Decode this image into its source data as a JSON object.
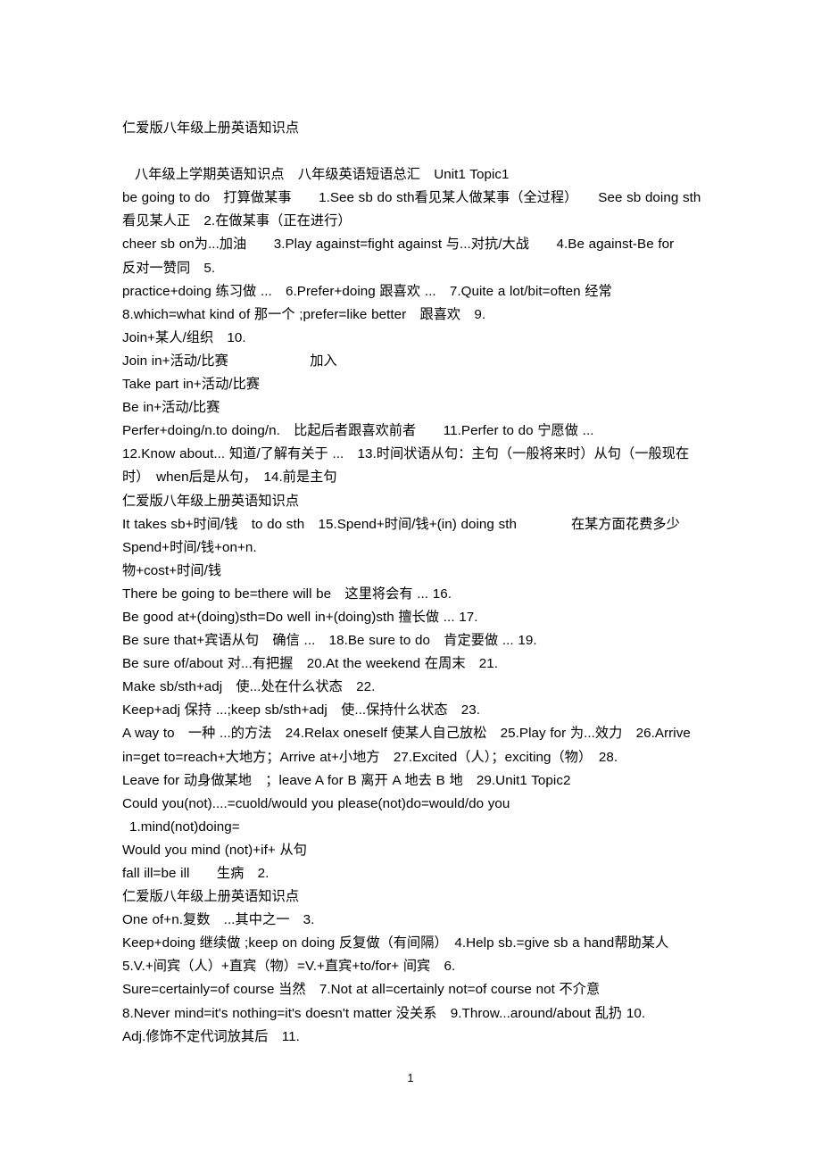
{
  "document": {
    "title": "仁爱版八年级上册英语知识点",
    "page_number": "1",
    "lines": [
      {
        "id": "l01",
        "text": "仁爱版八年级上册英语知识点",
        "indent": "none"
      },
      {
        "id": "l02",
        "text": "",
        "indent": "none"
      },
      {
        "id": "l03",
        "text": "八年级上学期英语知识点　八年级英语短语总汇　Unit1 Topic1",
        "indent": "sm"
      },
      {
        "id": "l04",
        "text": "be going to do　打算做某事　　1.See sb do sth看见某人做某事（全过程）　　See sb doing sth看见某人正　2.在做某事（正在进行）",
        "indent": "none"
      },
      {
        "id": "l05",
        "text": "cheer sb on为...加油　　3.Play against=fight against 与...对抗/大战　　4.Be against-Be for　　反对一赞同　5.",
        "indent": "none"
      },
      {
        "id": "l06",
        "text": "practice+doing 练习做 ...　6.Prefer+doing 跟喜欢 ...　7.Quite a lot/bit=often 经常",
        "indent": "none"
      },
      {
        "id": "l07",
        "text": "8.which=what kind of 那一个 ;prefer=like better　跟喜欢　9.",
        "indent": "none"
      },
      {
        "id": "l08",
        "text": "Join+某人/组织　10.",
        "indent": "none"
      },
      {
        "id": "l09",
        "text": "Join in+活动/比赛　　　　　　加入",
        "indent": "none"
      },
      {
        "id": "l10",
        "text": "Take part in+活动/比赛",
        "indent": "none"
      },
      {
        "id": "l11",
        "text": "Be in+活动/比赛",
        "indent": "none"
      },
      {
        "id": "l12",
        "text": "Perfer+doing/n.to doing/n.　比起后者跟喜欢前者　　11.Perfer to do 宁愿做 ...",
        "indent": "none"
      },
      {
        "id": "l13",
        "text": "12.Know about... 知道/了解有关于 ...　13.时间状语从句：主句（一般将来时）从句（一般现在时）　when后是从句，　14.前是主句",
        "indent": "none"
      },
      {
        "id": "l14",
        "text": "仁爱版八年级上册英语知识点",
        "indent": "none"
      },
      {
        "id": "l15",
        "text": "It takes sb+时间/钱　to do sth　15.Spend+时间/钱+(in) doing sth　　　　在某方面花费多少",
        "indent": "none"
      },
      {
        "id": "l16",
        "text": "Spend+时间/钱+on+n.",
        "indent": "none"
      },
      {
        "id": "l17",
        "text": "物+cost+时间/钱",
        "indent": "none"
      },
      {
        "id": "l18",
        "text": "There be going to be=there will be　这里将会有 ... 16.",
        "indent": "none"
      },
      {
        "id": "l19",
        "text": "Be good at+(doing)sth=Do well in+(doing)sth 擅长做 ... 17.",
        "indent": "none"
      },
      {
        "id": "l20",
        "text": "Be sure that+宾语从句　确信 ...　18.Be sure to do　肯定要做 ... 19.",
        "indent": "none"
      },
      {
        "id": "l21",
        "text": "Be sure of/about 对...有把握　20.At the weekend 在周末　21.",
        "indent": "none"
      },
      {
        "id": "l22",
        "text": "Make sb/sth+adj　使...处在什么状态　22.",
        "indent": "none"
      },
      {
        "id": "l23",
        "text": "Keep+adj 保持 ...;keep sb/sth+adj　使...保持什么状态　23.",
        "indent": "none"
      },
      {
        "id": "l24",
        "text": "A way to　一种 ...的方法　24.Relax oneself 使某人自己放松　25.Play for 为...效力　26.Arrive in=get to=reach+大地方；Arrive at+小地方　27.Excited（人）；exciting（物）　28.",
        "indent": "none"
      },
      {
        "id": "l25",
        "text": "Leave for 动身做某地　；leave A for B 离开 A 地去 B 地　29.Unit1 Topic2",
        "indent": "none"
      },
      {
        "id": "l26",
        "text": "Could you(not)....=cuold/would you please(not)do=would/do you",
        "indent": "none"
      },
      {
        "id": "l27",
        "text": "1.mind(not)doing=",
        "indent": "xs"
      },
      {
        "id": "l28",
        "text": "Would you mind (not)+if+ 从句",
        "indent": "none"
      },
      {
        "id": "l29",
        "text": "fall ill=be ill　　生病　2.",
        "indent": "none"
      },
      {
        "id": "l30",
        "text": "仁爱版八年级上册英语知识点",
        "indent": "none"
      },
      {
        "id": "l31",
        "text": "One of+n.复数　...其中之一　3.",
        "indent": "none"
      },
      {
        "id": "l32",
        "text": "Keep+doing 继续做 ;keep on doing 反复做（有间隔）　4.Help sb.=give sb a hand帮助某人　5.V.+间宾（人）+直宾（物）=V.+直宾+to/for+ 间宾　6.",
        "indent": "none"
      },
      {
        "id": "l33",
        "text": "Sure=certainly=of course 当然　7.Not at all=certainly not=of course not 不介意",
        "indent": "none"
      },
      {
        "id": "l34",
        "text": "8.Never mind=it's nothing=it's doesn't matter 没关系　9.Throw...around/about 乱扔 10.",
        "indent": "none"
      },
      {
        "id": "l35",
        "text": "Adj.修饰不定代词放其后　11.",
        "indent": "none"
      }
    ]
  }
}
